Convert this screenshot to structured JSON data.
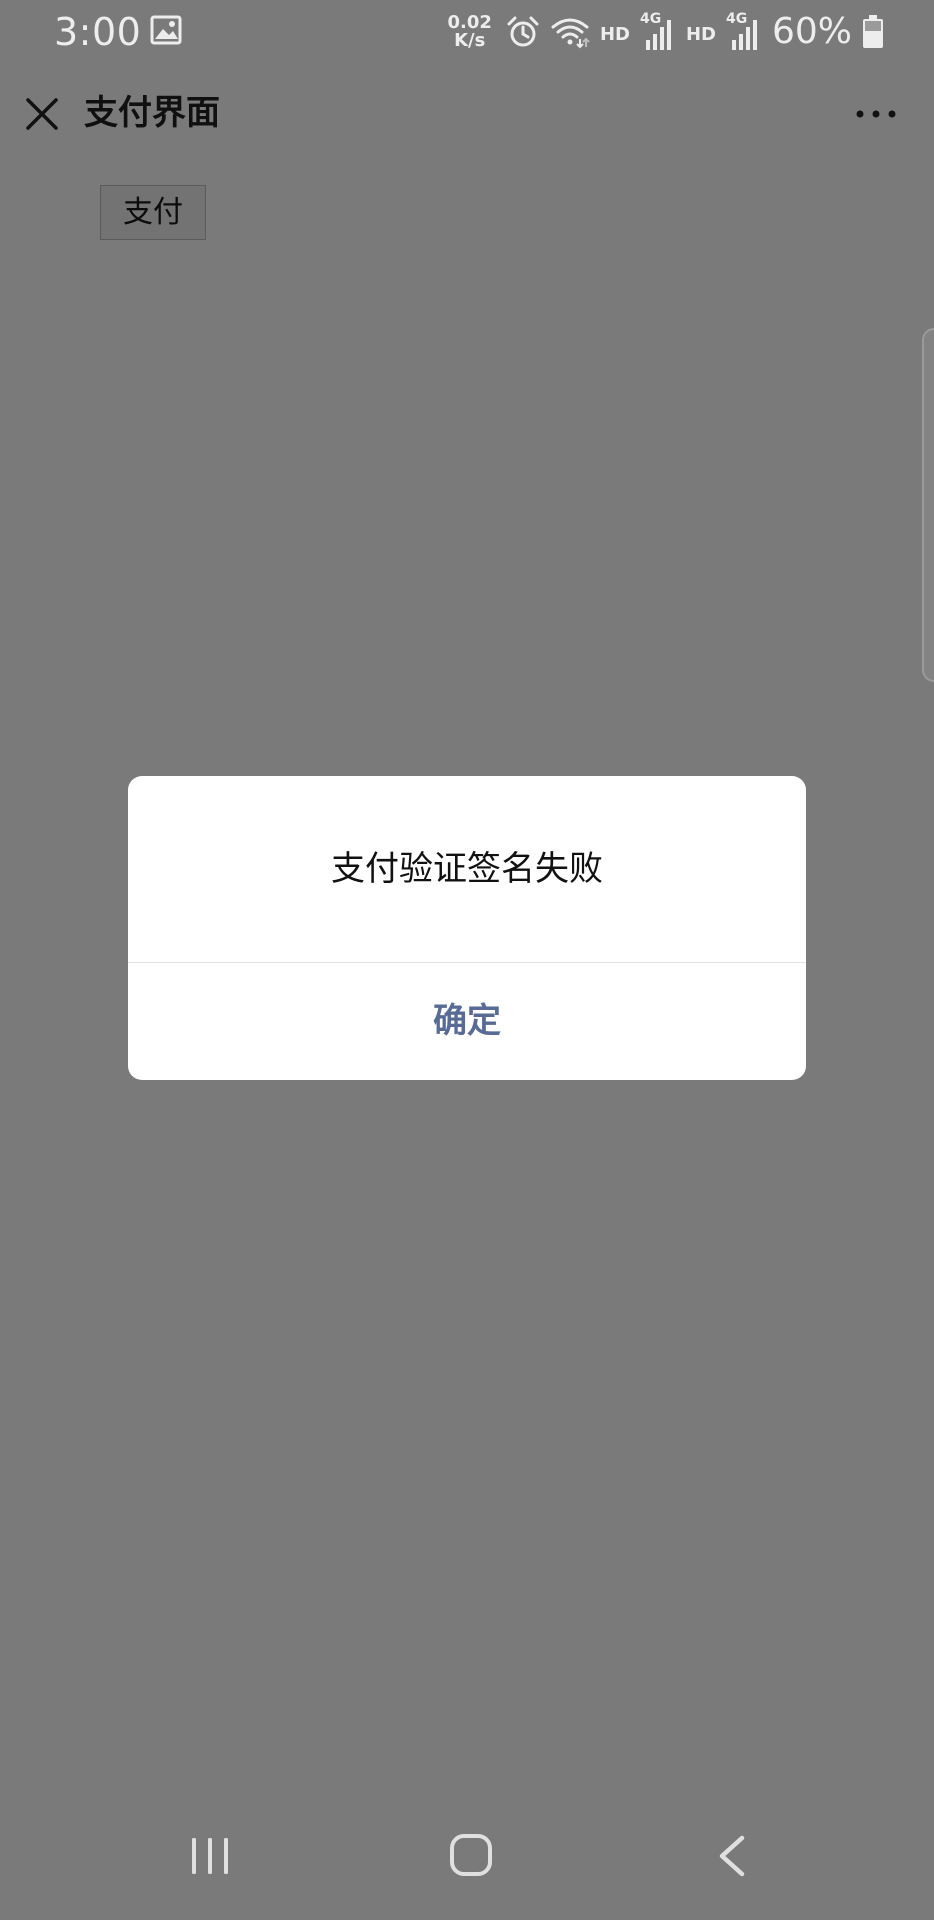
{
  "status_bar": {
    "time": "3:00",
    "net_speed_value": "0.02",
    "net_speed_unit": "K/s",
    "sim1_label": "HD",
    "sim1_network": "4G",
    "sim2_label": "HD",
    "sim2_network": "4G",
    "battery_percent": "60%",
    "icons": [
      "gallery-icon",
      "alarm-icon",
      "wifi-icon",
      "signal-icon",
      "battery-icon"
    ]
  },
  "title_bar": {
    "title": "支付界面",
    "close_icon": "close-icon",
    "more_icon": "more-icon"
  },
  "content": {
    "pay_button_label": "支付"
  },
  "dialog": {
    "message": "支付验证签名失败",
    "confirm_label": "确定"
  },
  "nav_bar": {
    "icons": [
      "recents-icon",
      "home-icon",
      "back-icon"
    ]
  },
  "colors": {
    "overlay_background": "#7a7a7a",
    "dialog_background": "#ffffff",
    "confirm_text": "#576b95",
    "status_text": "#ededed"
  }
}
